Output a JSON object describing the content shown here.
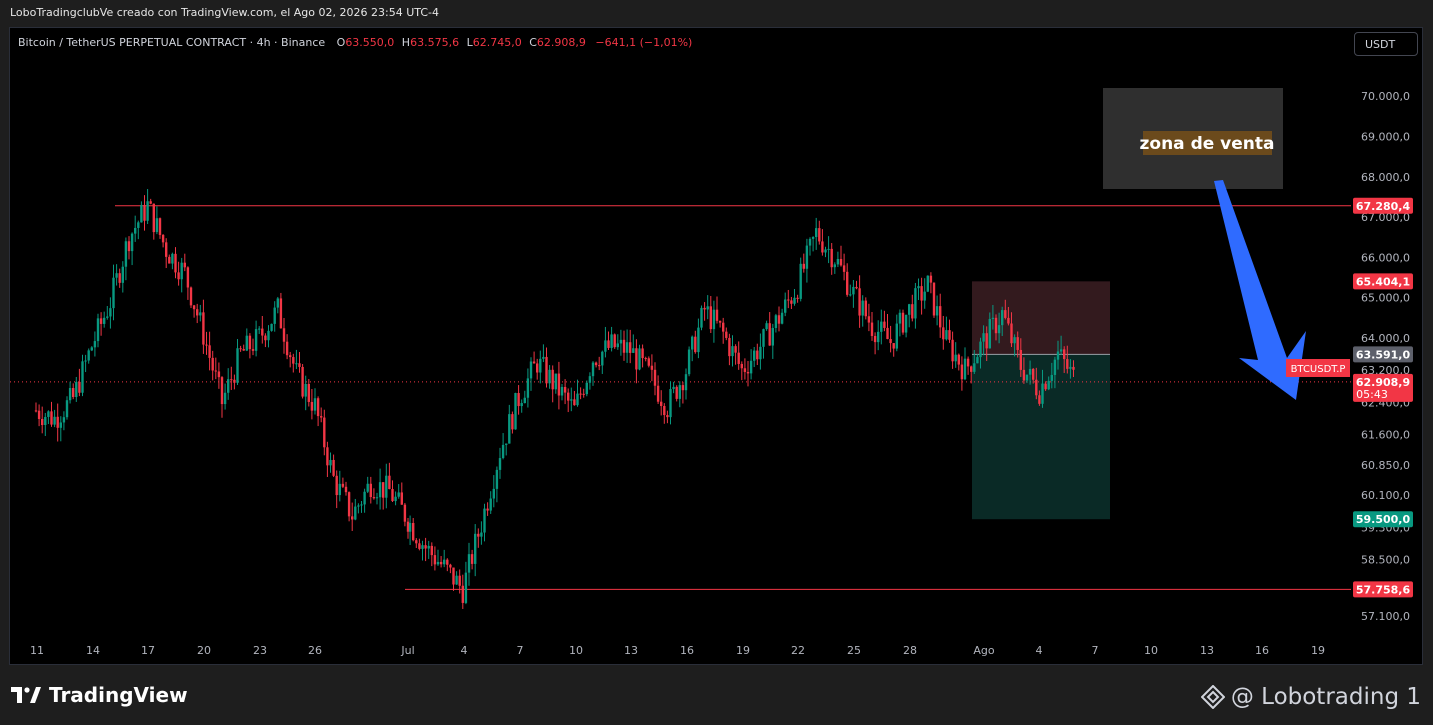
{
  "header": {
    "title": "LoboTradingclubVe creado con TradingView.com, el Ago 02, 2026 23:54 UTC-4"
  },
  "legend": {
    "symbol": "Bitcoin / TetherUS PERPETUAL CONTRACT · 4h · Binance",
    "o_label": "O",
    "o_value": "63.550,0",
    "h_label": "H",
    "h_value": "63.575,6",
    "l_label": "L",
    "l_value": "62.745,0",
    "c_label": "C",
    "c_value": "62.908,9",
    "change": "−641,1 (−1,01%)"
  },
  "toolbar": {
    "currency": "USDT"
  },
  "footer": {
    "brand": "TradingView",
    "author": "@ Lobotrading 1"
  },
  "colors": {
    "up": "#089981",
    "down": "#f23645",
    "level_line": "#f23645",
    "tp_zone": "#0a2a26",
    "sl_zone": "#331a1e",
    "arrow": "#2f6bff",
    "annotation_bg": "#6b4a1c",
    "zone_box": "#2f2f2f"
  },
  "chart_data": {
    "type": "candlestick",
    "symbol": "BTCUSDT.P",
    "timeframe": "4h",
    "ylim": [
      56700,
      70700
    ],
    "y_ticks": [
      "70.000,0",
      "69.000,0",
      "68.000,0",
      "67.000,0",
      "66.000,0",
      "65.000,0",
      "64.000,0",
      "63.200,0",
      "62.400,0",
      "61.600,0",
      "60.850,0",
      "60.100,0",
      "59.300,0",
      "58.500,0",
      "57.100,0"
    ],
    "x_ticks": [
      "11",
      "14",
      "17",
      "20",
      "23",
      "26",
      "Jul",
      "4",
      "7",
      "10",
      "13",
      "16",
      "19",
      "22",
      "25",
      "28",
      "Ago",
      "4",
      "7",
      "10",
      "13",
      "16",
      "19"
    ],
    "price_path": [
      [
        10,
        62200
      ],
      [
        11,
        62000
      ],
      [
        12,
        62500
      ],
      [
        13,
        63800
      ],
      [
        14,
        64900
      ],
      [
        15,
        66500
      ],
      [
        16,
        67280
      ],
      [
        17,
        66200
      ],
      [
        18,
        65600
      ],
      [
        19,
        64100
      ],
      [
        20,
        62400
      ],
      [
        21,
        63600
      ],
      [
        22,
        64000
      ],
      [
        23,
        64700
      ],
      [
        24,
        63100
      ],
      [
        25,
        62300
      ],
      [
        26,
        60500
      ],
      [
        27,
        59600
      ],
      [
        28,
        60400
      ],
      [
        29,
        60200
      ],
      [
        30,
        59500
      ],
      [
        31,
        58800
      ],
      [
        32,
        58300
      ],
      [
        33,
        57760
      ],
      [
        34,
        59400
      ],
      [
        35,
        61200
      ],
      [
        36,
        62500
      ],
      [
        37,
        63400
      ],
      [
        38,
        62800
      ],
      [
        39,
        62200
      ],
      [
        40,
        63500
      ],
      [
        41,
        63800
      ],
      [
        42,
        63700
      ],
      [
        43,
        63100
      ],
      [
        44,
        62300
      ],
      [
        45,
        63200
      ],
      [
        46,
        64700
      ],
      [
        47,
        64100
      ],
      [
        48,
        63200
      ],
      [
        49,
        63800
      ],
      [
        50,
        64500
      ],
      [
        51,
        65300
      ],
      [
        52,
        66600
      ],
      [
        53,
        66000
      ],
      [
        54,
        65100
      ],
      [
        55,
        64300
      ],
      [
        56,
        63900
      ],
      [
        57,
        64700
      ],
      [
        58,
        65300
      ],
      [
        59,
        63900
      ],
      [
        60,
        63200
      ],
      [
        61,
        63900
      ],
      [
        62,
        64600
      ],
      [
        63,
        63300
      ],
      [
        64,
        62700
      ],
      [
        65,
        63600
      ],
      [
        66,
        62908.9
      ]
    ],
    "levels": [
      {
        "value": 67280.4,
        "label": "67.280,4"
      },
      {
        "value": 57758.6,
        "label": "57.758,6"
      }
    ],
    "price_labels": [
      {
        "value": 65404.1,
        "label": "65.404,1",
        "kind": "stop"
      },
      {
        "value": 63591.0,
        "label": "63.591,0",
        "kind": "entry"
      },
      {
        "value": 62908.9,
        "label": "62.908,9",
        "kind": "last",
        "countdown": "05:43"
      },
      {
        "value": 59500.0,
        "label": "59.500,0",
        "kind": "target"
      }
    ],
    "position": {
      "entry": 63591.0,
      "stop": 65404.1,
      "target": 59500.0
    },
    "annotation": "zona de venta",
    "symbol_tag": "BTCUSDT.P"
  }
}
